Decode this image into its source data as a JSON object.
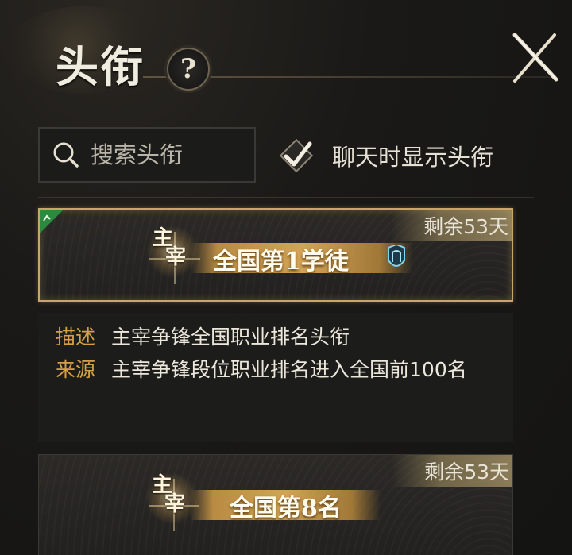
{
  "header": {
    "title": "头衔",
    "help_label": "?"
  },
  "search": {
    "placeholder": "搜索头衔"
  },
  "chat_toggle": {
    "label": "聊天时显示头衔",
    "checked": true
  },
  "titles": [
    {
      "emblem_line1": "主",
      "emblem_line2": "宰",
      "name": "全国第1学徒",
      "remaining": "剩余53天",
      "selected": true,
      "has_corner_tag": true,
      "has_rank_icon": true
    },
    {
      "emblem_line1": "主",
      "emblem_line2": "宰",
      "name": "全国第8名",
      "remaining": "剩余53天",
      "selected": false,
      "has_corner_tag": false,
      "has_rank_icon": false
    }
  ],
  "detail": {
    "desc_label": "描述",
    "desc_value": "主宰争锋全国职业排名头衔",
    "source_label": "来源",
    "source_value": "主宰争锋段位职业排名进入全国前100名"
  },
  "colors": {
    "accent_gold": "#d6a049",
    "selected_border": "#c9a56c",
    "corner_tag_green": "#2c8a3e"
  },
  "icons": {
    "help": "question-icon",
    "close": "close-icon",
    "search": "search-icon",
    "check": "check-icon",
    "rank": "rank-badge-icon",
    "corner": "equipped-tag-icon"
  }
}
